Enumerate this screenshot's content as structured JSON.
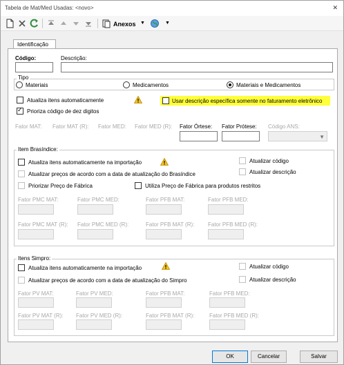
{
  "window": {
    "title": "Tabela de Mat/Med Usadas: <novo>",
    "close_glyph": "✕"
  },
  "toolbar": {
    "anexos_label": "Anexos"
  },
  "tabs": {
    "identificacao": "Identificação"
  },
  "fields": {
    "codigo_label": "Código:",
    "descricao_label": "Descrição:",
    "codigo_value": "",
    "descricao_value": ""
  },
  "tipo": {
    "title": "Tipo",
    "options": [
      "Materiais",
      "Medicamentos",
      "Materiais e Medicamentos"
    ],
    "selected": "Materiais e Medicamentos"
  },
  "checks": {
    "atualiza_auto": "Atualiza itens automaticamente",
    "usar_descricao": "Usar descrição específica somente no faturamento eletrônico",
    "prioriza_codigo": "Prioriza código de dez digitos"
  },
  "fatores": {
    "labels": [
      "Fator MAT:",
      "Fator MAT (R):",
      "Fator MED:",
      "Fator MED (R):",
      "Fator Órtese:",
      "Fator Prótese:",
      "Código ANS:"
    ]
  },
  "brasindice": {
    "title": "Item Brasíndice:",
    "atualiza_importacao": "Atualiza itens automaticamente na importação",
    "atualizar_codigo": "Atualizar código",
    "atualizar_descricao": "Atualizar descrição",
    "atualizar_precos": "Atualizar preços de acordo com a data de atualização do Brasíndice",
    "priorizar_preco": "Priorizar Preço de Fábrica",
    "utiliza_preco": "Utiliza Preço de Fábrica para produtos restritos",
    "row1": [
      "Fator PMC MAT:",
      "Fator PMC MED:",
      "Fator PFB MAT:",
      "Fator PFB MED:"
    ],
    "row2": [
      "Fator PMC MAT (R):",
      "Fator PMC MED (R):",
      "Fator PFB MAT (R):",
      "Fator PFB MED (R):"
    ]
  },
  "simpro": {
    "title": "Itens Simpro:",
    "atualiza_importacao": "Atualiza itens automaticamente na importação",
    "atualizar_codigo": "Atualizar código",
    "atualizar_descricao": "Atualizar descrição",
    "atualizar_precos": "Atualizar preços de acordo com a data de atualização do Simpro",
    "row1": [
      "Fator PV MAT:",
      "Fator PV MED:",
      "Fator PFB MAT:",
      "Fator PFB MED:"
    ],
    "row2": [
      "Fator PV MAT (R):",
      "Fator PV MED (R):",
      "Fator PFB MAT (R):",
      "Fator PFB MED (R):"
    ]
  },
  "buttons": {
    "ok": "OK",
    "cancelar": "Cancelar",
    "salvar": "Salvar"
  },
  "colors": {
    "highlight": "#ffff3a",
    "warning": "#f5c518",
    "refresh": "#2e8b3a",
    "primary_border": "#0078d7"
  }
}
